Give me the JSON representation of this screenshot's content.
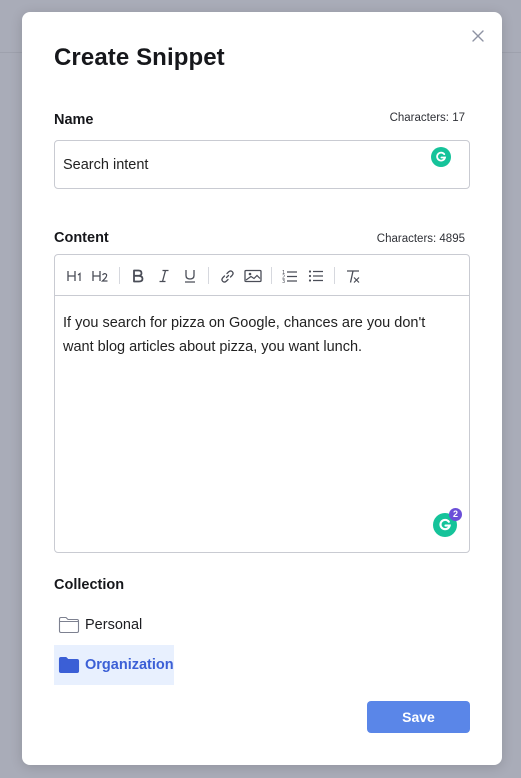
{
  "dialog": {
    "title": "Create Snippet"
  },
  "name_field": {
    "label": "Name",
    "char_count": "Characters: 17",
    "value": "Search intent"
  },
  "content_field": {
    "label": "Content",
    "char_count": "Characters: 4895",
    "text": "If you search for pizza on Google, chances are you don't want blog articles about pizza, you want lunch.",
    "grammarly_alerts": "2",
    "toolbar": [
      "heading-1",
      "heading-2",
      "bold",
      "italic",
      "underline",
      "link",
      "image",
      "ordered-list",
      "bullet-list",
      "clear-format"
    ]
  },
  "collection": {
    "label": "Collection",
    "items": [
      {
        "label": "Personal",
        "selected": false
      },
      {
        "label": "Organization",
        "selected": true
      }
    ]
  },
  "actions": {
    "save_label": "Save"
  },
  "colors": {
    "accent": "#5a86e8",
    "selected_text": "#3b5fd6",
    "selected_bg": "#e8f0fe",
    "grammarly": "#15c39a",
    "badge": "#6b4fd8"
  }
}
